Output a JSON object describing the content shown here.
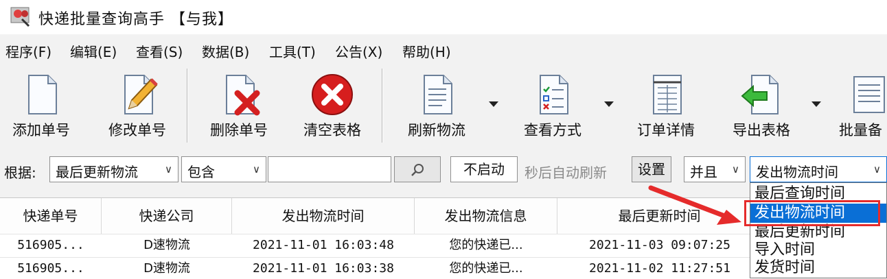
{
  "window": {
    "title": "快递批量查询高手 【与我】"
  },
  "menu": [
    "程序(F)",
    "编辑(E)",
    "查看(S)",
    "数据(B)",
    "工具(T)",
    "公告(X)",
    "帮助(H)"
  ],
  "toolbar": {
    "buttons": [
      "添加单号",
      "修改单号",
      "删除单号",
      "清空表格",
      "刷新物流",
      "查看方式",
      "订单详情",
      "导出表格",
      "批量备"
    ]
  },
  "filter": {
    "label": "根据:",
    "field_select": "最后更新物流",
    "match_select": "包含",
    "search_value": "",
    "auto_refresh_value": "不启动",
    "auto_refresh_text": "秒后自动刷新",
    "settings_button": "设置",
    "logic_select": "并且",
    "time_select": "发出物流时间"
  },
  "dropdown": {
    "options": [
      "最后查询时间",
      "发出物流时间",
      "最后更新时间",
      "导入时间",
      "发货时间"
    ],
    "selected": "发出物流时间"
  },
  "table": {
    "headers": [
      "快递单号",
      "快递公司",
      "发出物流时间",
      "发出物流信息",
      "最后更新时间"
    ],
    "rows": [
      [
        "516905...",
        "D速物流",
        "2021-11-01 16:03:48",
        "您的快递已...",
        "2021-11-03 09:07:25"
      ],
      [
        "516905...",
        "D速物流",
        "2021-11-01 16:03:38",
        "您的快递已...",
        "2021-11-02 11:27:51"
      ]
    ]
  },
  "colors": {
    "selection": "#0a6fd6",
    "annotation": "#e52b2b",
    "delete_icon": "#d42020"
  }
}
